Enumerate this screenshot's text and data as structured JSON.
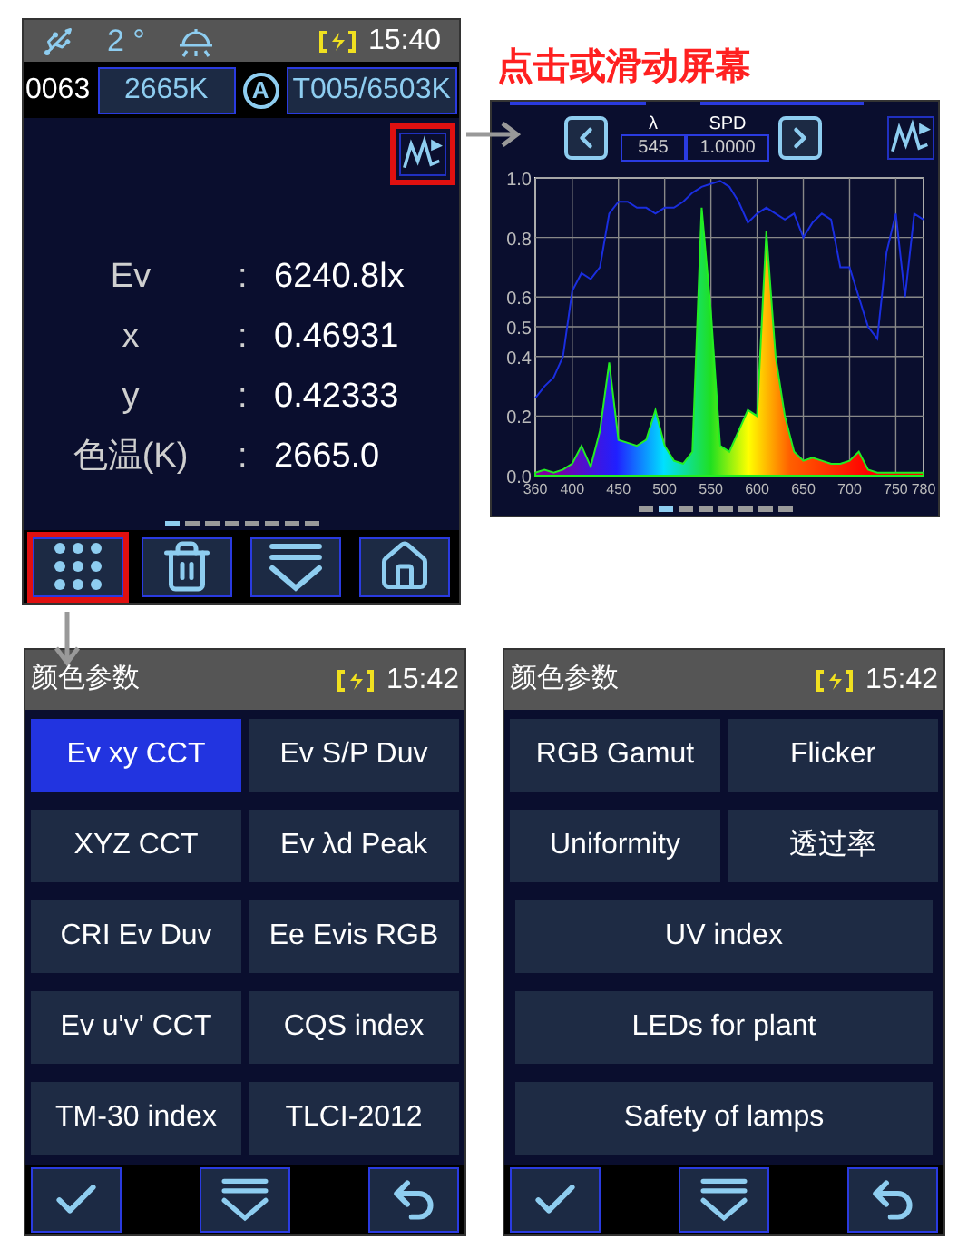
{
  "annotation": {
    "text": "点击或滑动屏幕"
  },
  "main_screen": {
    "status_bar": {
      "angle": "2 °",
      "time": "15:40"
    },
    "info_row": {
      "count": "0063",
      "cct": "2665K",
      "mode": "A",
      "target": "T005/6503K"
    },
    "readings": [
      {
        "label": "Ev",
        "separator": ":",
        "value": "6240.8lx"
      },
      {
        "label": "x",
        "separator": ":",
        "value": "0.46931"
      },
      {
        "label": "y",
        "separator": ":",
        "value": "0.42333"
      },
      {
        "label": "色温(K)",
        "separator": ":",
        "value": "2665.0"
      }
    ],
    "pages": [
      {
        "selected": true
      },
      {
        "selected": false
      },
      {
        "selected": false
      },
      {
        "selected": false
      },
      {
        "selected": false
      },
      {
        "selected": false
      },
      {
        "selected": false
      },
      {
        "selected": false
      }
    ],
    "toolbar": [
      {
        "kind": "grid",
        "highlighted": true
      },
      {
        "kind": "trash",
        "highlighted": false
      },
      {
        "kind": "more",
        "highlighted": false
      },
      {
        "kind": "home",
        "highlighted": false
      }
    ],
    "chart_button": {
      "highlighted": true
    }
  },
  "spectrum_screen": {
    "header": [
      {
        "label": "λ",
        "value": "545"
      },
      {
        "label": "SPD",
        "value": "1.0000"
      }
    ],
    "chart_data": {
      "type": "area",
      "x": [
        360,
        370,
        380,
        390,
        400,
        410,
        420,
        430,
        440,
        450,
        460,
        470,
        480,
        490,
        500,
        510,
        520,
        530,
        540,
        550,
        560,
        570,
        580,
        590,
        600,
        610,
        620,
        630,
        640,
        650,
        660,
        670,
        680,
        690,
        700,
        710,
        720,
        730,
        740,
        750,
        760,
        770,
        780
      ],
      "series": [
        {
          "color": "#22ee22",
          "values": [
            0.01,
            0.02,
            0.01,
            0.02,
            0.04,
            0.1,
            0.03,
            0.15,
            0.38,
            0.12,
            0.11,
            0.1,
            0.12,
            0.22,
            0.1,
            0.05,
            0.04,
            0.08,
            0.9,
            0.55,
            0.1,
            0.08,
            0.15,
            0.22,
            0.2,
            0.82,
            0.4,
            0.2,
            0.08,
            0.05,
            0.06,
            0.05,
            0.04,
            0.04,
            0.05,
            0.08,
            0.02,
            0.01,
            0.01,
            0.01,
            0.01,
            0.01,
            0.01
          ]
        },
        {
          "type": "line",
          "color": "#1a2ee0",
          "values": [
            0.26,
            0.3,
            0.33,
            0.4,
            0.62,
            0.68,
            0.66,
            0.7,
            0.88,
            0.92,
            0.92,
            0.9,
            0.9,
            0.88,
            0.9,
            0.9,
            0.92,
            0.95,
            0.97,
            0.98,
            0.99,
            0.97,
            0.92,
            0.85,
            0.88,
            0.9,
            0.88,
            0.86,
            0.88,
            0.8,
            0.85,
            0.88,
            0.86,
            0.7,
            0.7,
            0.6,
            0.5,
            0.46,
            0.75,
            0.88,
            0.6,
            0.88,
            0.86
          ]
        }
      ],
      "xlim": [
        360,
        780
      ],
      "ylim": [
        0,
        1
      ],
      "grid": true,
      "xticks": [
        360,
        400,
        450,
        500,
        550,
        600,
        650,
        700,
        750,
        780
      ],
      "yticks": [
        {
          "value": 0,
          "label": "0.0"
        },
        {
          "value": 0.2,
          "label": "0.2"
        },
        {
          "value": 0.4,
          "label": "0.4"
        },
        {
          "value": 0.5,
          "label": "0.5"
        },
        {
          "value": 0.6,
          "label": "0.6"
        },
        {
          "value": 0.8,
          "label": "0.8"
        },
        {
          "value": 1,
          "label": "1.0"
        }
      ]
    },
    "pages": [
      {
        "selected": false
      },
      {
        "selected": true
      },
      {
        "selected": false
      },
      {
        "selected": false
      },
      {
        "selected": false
      },
      {
        "selected": false
      },
      {
        "selected": false
      },
      {
        "selected": false
      }
    ]
  },
  "menu_screens": [
    {
      "title": "颜色参数",
      "time": "15:42",
      "items": [
        {
          "label": "Ev xy CCT",
          "kind": "half",
          "selected": true
        },
        {
          "label": "Ev S/P Duv",
          "kind": "half",
          "selected": false
        },
        {
          "label": "XYZ CCT",
          "kind": "half",
          "selected": false
        },
        {
          "label": "Ev λd Peak",
          "kind": "half",
          "selected": false
        },
        {
          "label": "CRI Ev Duv",
          "kind": "half",
          "selected": false
        },
        {
          "label": "Ee Evis RGB",
          "kind": "half",
          "selected": false
        },
        {
          "label": "Ev u'v' CCT",
          "kind": "half",
          "selected": false
        },
        {
          "label": "CQS index",
          "kind": "half",
          "selected": false
        },
        {
          "label": "TM-30 index",
          "kind": "half",
          "selected": false
        },
        {
          "label": "TLCI-2012",
          "kind": "half",
          "selected": false
        }
      ]
    },
    {
      "title": "颜色参数",
      "time": "15:42",
      "items": [
        {
          "label": "RGB Gamut",
          "kind": "half",
          "selected": false
        },
        {
          "label": "Flicker",
          "kind": "half",
          "selected": false
        },
        {
          "label": "Uniformity",
          "kind": "half",
          "selected": false
        },
        {
          "label": "透过率",
          "kind": "half",
          "selected": false
        },
        {
          "label": "UV index",
          "kind": "full",
          "selected": false
        },
        {
          "label": "LEDs for plant",
          "kind": "full",
          "selected": false
        },
        {
          "label": "Safety of lamps",
          "kind": "full",
          "selected": false
        }
      ]
    }
  ]
}
